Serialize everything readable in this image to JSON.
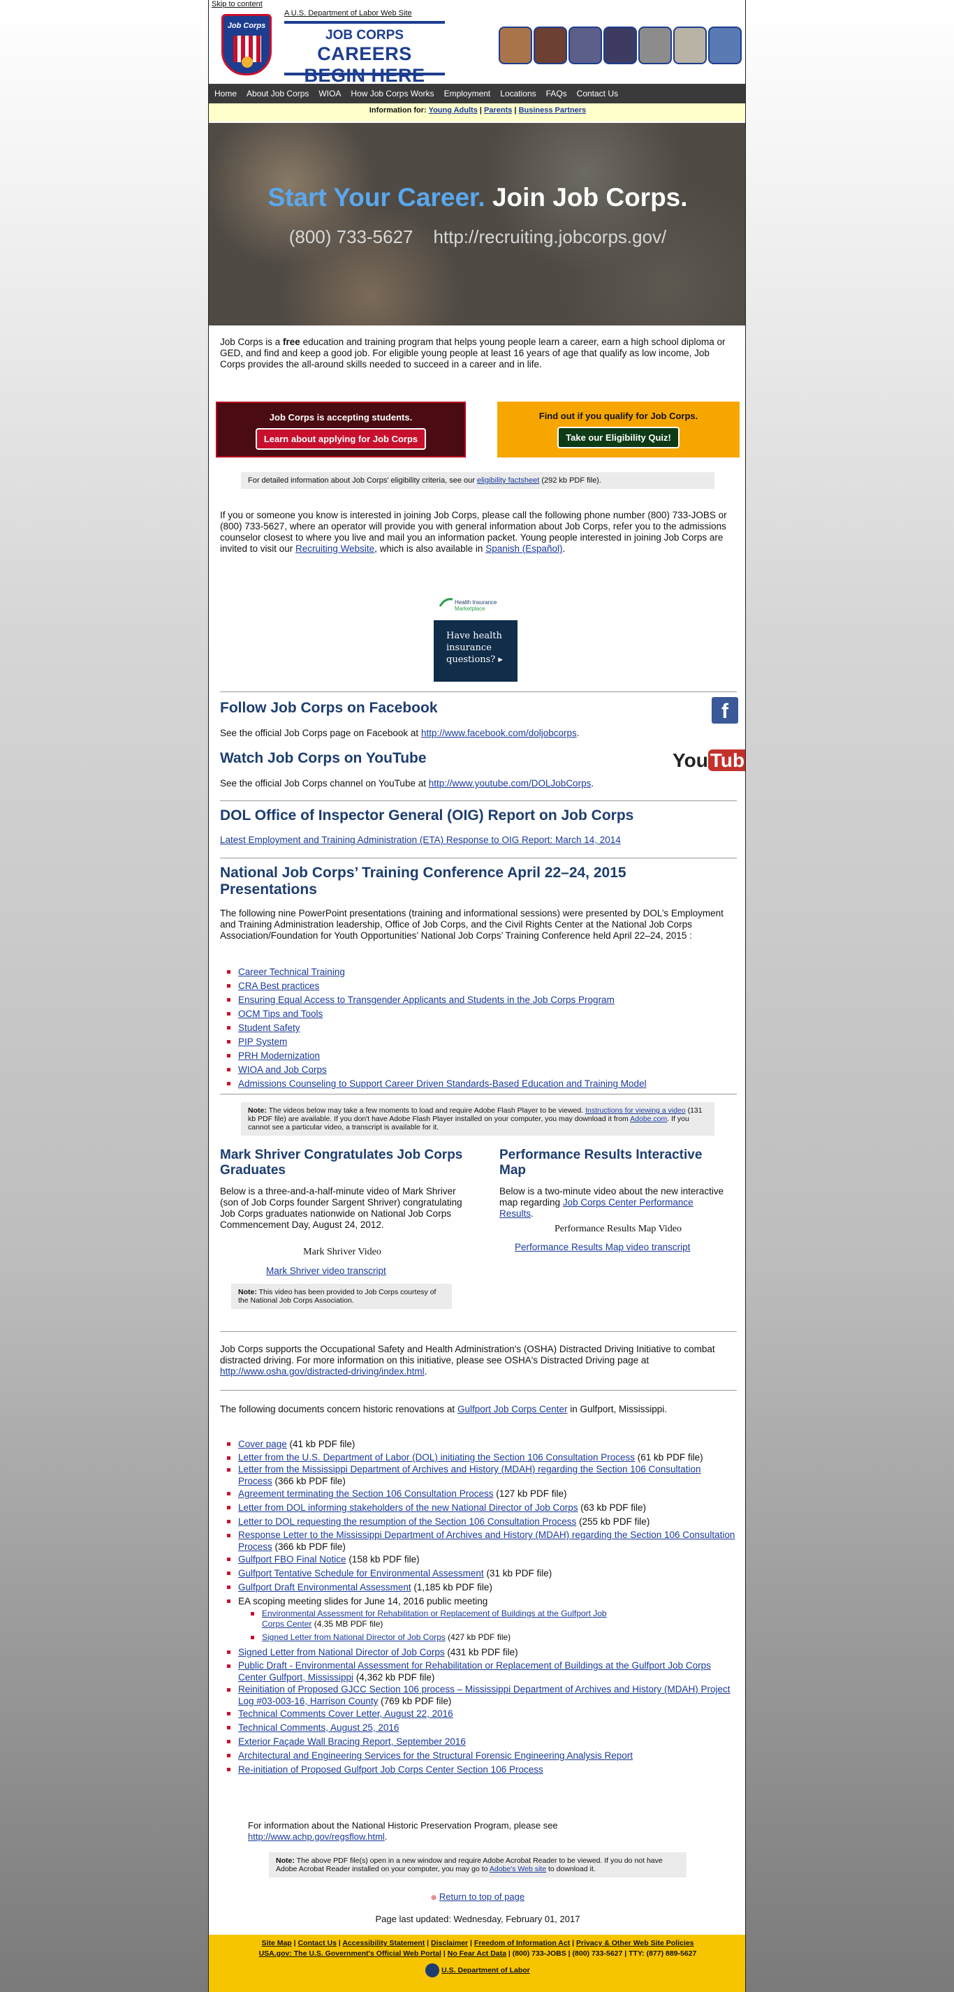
{
  "skip_link": "Skip to content",
  "header": {
    "dol_link": "A U.S. Department of Labor Web Site",
    "logo_text": "Job Corps",
    "brand_line1": "JOB CORPS",
    "brand_line2": "CAREERS BEGIN HERE"
  },
  "nav": [
    "Home",
    "About Job Corps",
    "WIOA",
    "How Job Corps Works",
    "Employment",
    "Locations",
    "FAQs",
    "Contact Us"
  ],
  "info_for": {
    "label": "Information for:",
    "links": [
      "Young Adults",
      "Parents",
      "Business Partners"
    ]
  },
  "hero": {
    "title_blue": "Start Your Career.",
    "title_white": "Join Job Corps.",
    "phone": "(800) 733-5627",
    "url": "http://recruiting.jobcorps.gov/"
  },
  "intro": {
    "before": "Job Corps is a ",
    "bold": "free",
    "after": " education and training program that helps young people learn a career, earn a high school diploma or GED, and find and keep a good job. For eligible young people at least 16 years of age that qualify as low income, Job Corps provides the all-around skills needed to succeed in a career and in life."
  },
  "cta": {
    "left_text": "Job Corps is accepting students.",
    "left_button": "Learn about applying for Job Corps",
    "right_text": "Find out if you qualify for Job Corps.",
    "right_button": "Take our Eligibility Quiz!"
  },
  "eligibility_note": {
    "before": "For detailed information about Job Corps' eligibility criteria, see our ",
    "link": "eligibility factsheet",
    "after": " (292 kb PDF file)."
  },
  "contact_para": {
    "text": "If you or someone you know is interested in joining Job Corps, please call the following phone number (800) 733-JOBS or (800) 733-5627, where an operator will provide you with general information about Job Corps, refer you to the admissions counselor closest to where you live and mail you an information packet. Young people interested in joining Job Corps are invited to visit our ",
    "link1": "Recruiting Website",
    "mid": ", which is also available in ",
    "link2": "Spanish (Español)",
    "end": "."
  },
  "health": {
    "logo_line1": "Health Insurance",
    "logo_line2": "Marketplace",
    "box": "Have health insurance questions?"
  },
  "facebook": {
    "heading": "Follow Job Corps on Facebook",
    "text": "See the official Job Corps page on Facebook at ",
    "link": "http://www.facebook.com/doljobcorps",
    "icon_letter": "f"
  },
  "youtube": {
    "heading": "Watch Job Corps on YouTube",
    "text": "See the official Job Corps channel on YouTube at ",
    "link": "http://www.youtube.com/DOLJobCorps",
    "logo_you": "You",
    "logo_tube": "Tube"
  },
  "oig": {
    "heading": "DOL Office of Inspector General (OIG) Report on Job Corps",
    "link": "Latest Employment and Training Administration (ETA) Response to OIG Report: March 14, 2014"
  },
  "conference": {
    "heading": "National Job Corps’ Training Conference April 22–24, 2015 Presentations",
    "text": "The following nine PowerPoint presentations (training and informational sessions) were presented by DOL’s Employment and Training Administration leadership, Office of Job Corps, and the Civil Rights Center at the National Job Corps Association/Foundation for Youth Opportunities’ National Job Corps’ Training Conference held April 22–24, 2015 :",
    "items": [
      "Career Technical Training",
      "CRA Best practices",
      "Ensuring Equal Access to Transgender Applicants and Students in the Job Corps Program",
      "OCM Tips and Tools",
      "Student Safety",
      "PIP System",
      "PRH Modernization",
      "WIOA and Job Corps",
      "Admissions Counseling to Support Career Driven Standards-Based Education and Training Model"
    ]
  },
  "video_note": {
    "label": "Note:",
    "before": " The videos below may take a few moments to load and require Adobe Flash Player to be viewed. ",
    "link1": "Instructions for viewing a video",
    "mid": " (131 kb PDF file) are available. If you don't have Adobe Flash Player installed on your computer, you may download it from ",
    "link2": "Adobe.com",
    "after": ". If you cannot see a particular video, a transcript is available for it."
  },
  "shriver": {
    "heading": "Mark Shriver Congratulates Job Corps Graduates",
    "text": "Below is a three-and-a-half-minute video of Mark Shriver (son of Job Corps founder Sargent Shriver) congratulating Job Corps graduates nationwide on National Job Corps Commencement Day, August 24, 2012.",
    "video_label": "Mark Shriver Video",
    "transcript": "Mark Shriver video transcript",
    "note_label": "Note:",
    "note_text": " This video has been provided to Job Corps courtesy of the National Job Corps Association."
  },
  "performance": {
    "heading": "Performance Results Interactive Map",
    "text": "Below is a two-minute video about the new interactive map regarding ",
    "link": "Job Corps Center Performance Results",
    "text_end": ".",
    "video_label": "Performance Results Map Video",
    "transcript": "Performance Results Map video transcript"
  },
  "osha": {
    "text": "Job Corps supports the Occupational Safety and Health Administration's (OSHA) Distracted Driving Initiative to combat distracted driving. For more information on this initiative, please see OSHA's Distracted Driving page at ",
    "link": "http://www.osha.gov/distracted-driving/index.html",
    "end": "."
  },
  "gulfport": {
    "before": "The following documents concern historic renovations at ",
    "link": "Gulfport Job Corps Center",
    "after": " in Gulfport, Mississippi.",
    "items": [
      {
        "link": "Cover page",
        "suffix": " (41 kb PDF file)"
      },
      {
        "link": "Letter from the U.S. Department of Labor (DOL) initiating the Section 106 Consultation Process",
        "suffix": " (61 kb PDF file)"
      },
      {
        "link": "Letter from the Mississippi Department of Archives and History (MDAH) regarding the Section 106 Consultation Process",
        "suffix": " (366 kb PDF file)"
      },
      {
        "link": "Agreement terminating the Section 106 Consultation Process",
        "suffix": " (127 kb PDF file)"
      },
      {
        "link": "Letter from DOL informing stakeholders of the new National Director of Job Corps",
        "suffix": " (63 kb PDF file)"
      },
      {
        "link": "Letter to DOL requesting the resumption of the Section 106 Consultation Process",
        "suffix": " (255 kb PDF file)"
      },
      {
        "link": "Response Letter to the Mississippi Department of Archives and History (MDAH) regarding the Section 106 Consultation Process",
        "suffix": " (366 kb PDF file)"
      },
      {
        "link": "Gulfport  FBO  Final Notice",
        "suffix": " (158 kb PDF file)"
      },
      {
        "link": "Gulfport Tentative Schedule for Environmental Assessment",
        "suffix": " (31 kb  PDF file)"
      },
      {
        "link": "Gulfport Draft Environmental Assessment",
        "suffix": " (1,185 kb PDF file)"
      }
    ],
    "scoping_text": "EA scoping meeting slides for June 14, 2016 public meeting",
    "sub_items": [
      {
        "link": "Environmental Assessment for Rehabilitation or Replacement of Buildings at the Gulfport Job Corps Center",
        "suffix": " (4.35 MB PDF file)"
      },
      {
        "link": "Signed Letter from National Director of Job Corps",
        "suffix": " (427 kb PDF file)"
      }
    ],
    "items2": [
      {
        "link": "Signed Letter from National Director of Job Corps",
        "suffix": " (431 kb PDF file)"
      },
      {
        "link": "Public Draft - Environmental Assessment for Rehabilitation or Replacement of Buildings at the Gulfport Job Corps Center Gulfport, Mississippi",
        "suffix": " (4,362 kb PDF file)"
      },
      {
        "link": "Reinitiation of Proposed GJCC Section 106 process – Mississippi Department of Archives and History (MDAH) Project Log #03-003-16, Harrison County",
        "suffix": " (769 kb PDF file)"
      },
      {
        "link": "Technical Comments Cover Letter, August 22, 2016",
        "suffix": ""
      },
      {
        "link": "Technical Comments, August 25, 2016",
        "suffix": ""
      },
      {
        "link": "Exterior Façade Wall Bracing Report, September 2016",
        "suffix": ""
      },
      {
        "link": "Architectural and Engineering Services for the Structural Forensic Engineering Analysis Report",
        "suffix": ""
      },
      {
        "link": "Re-initiation of Proposed Gulfport Job Corps Center Section 106 Process",
        "suffix": ""
      }
    ]
  },
  "nhpp": {
    "text": "For information about the National Historic Preservation Program, please see ",
    "link": "http://www.achp.gov/regsflow.html",
    "end": "."
  },
  "pdf_note": {
    "label": "Note:",
    "text": " The above PDF file(s) open in a new window and require Adobe Acrobat Reader to be viewed. If you do not have Adobe Acrobat Reader installed on your computer, you may go to ",
    "link": "Adobe's Web site",
    "end": " to download it."
  },
  "return_top": "Return to top of page",
  "last_updated": "Page last updated: Wednesday, February 01, 2017",
  "footer": {
    "row1": [
      "Site Map",
      "Contact Us",
      "Accessibility Statement",
      "Disclaimer",
      "Freedom of Information Act",
      "Privacy & Other Web Site Policies"
    ],
    "row2_link": "USA.gov: The U.S. Government's Official Web Portal",
    "row2_link2": "No Fear Act Data",
    "row2_text": " | (800) 733-JOBS | (800) 733-5627 | TTY: (877) 889-5627",
    "dol": "U.S. Department of Labor"
  },
  "colors": {
    "navy": "#1d3d6f",
    "nav_bg": "#3a3a3a",
    "cta_red": "#4a0b12",
    "cta_orange": "#f7a600",
    "footer_yellow": "#f7c400",
    "bullet_red": "#c8102e"
  }
}
